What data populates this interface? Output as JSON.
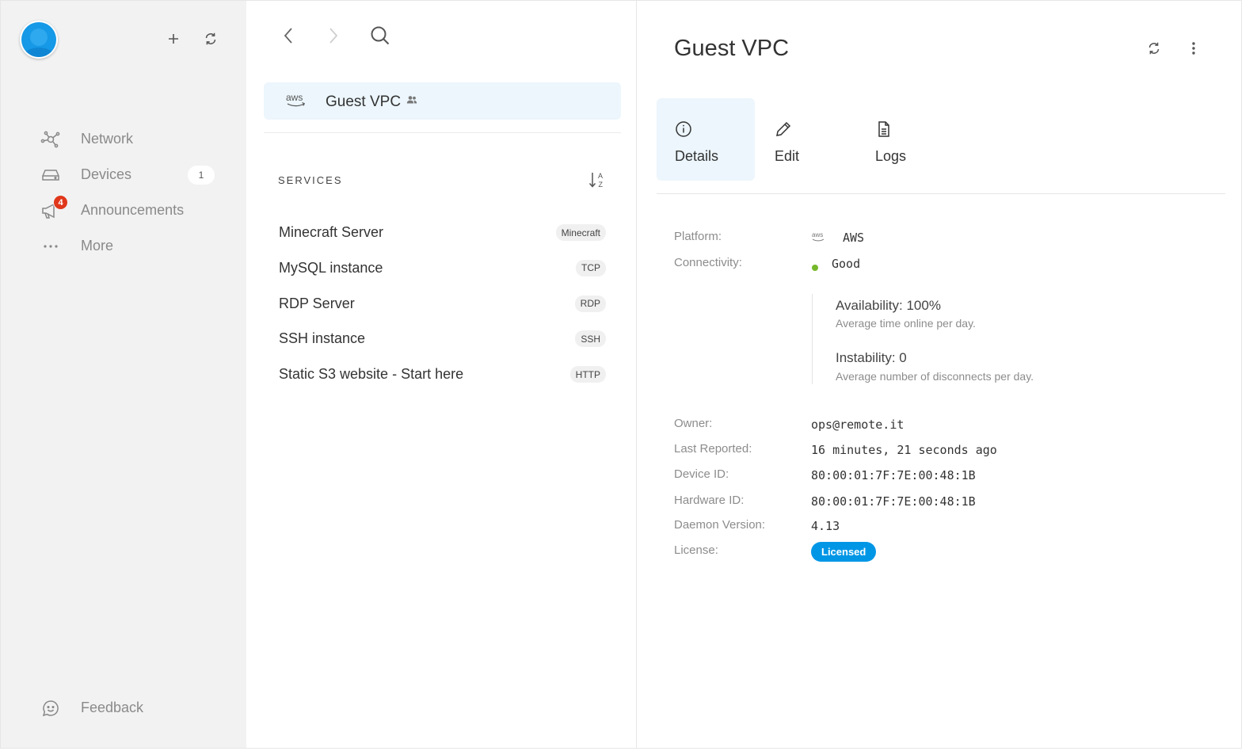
{
  "sidebar": {
    "nav": [
      {
        "label": "Network",
        "icon": "network-icon"
      },
      {
        "label": "Devices",
        "icon": "devices-icon",
        "count": "1"
      },
      {
        "label": "Announcements",
        "icon": "megaphone-icon",
        "badge": "4"
      },
      {
        "label": "More",
        "icon": "more-horizontal-icon"
      }
    ],
    "feedback_label": "Feedback"
  },
  "middle": {
    "device": {
      "platform_logo": "aws",
      "name": "Guest VPC"
    },
    "services_title": "SERVICES",
    "services": [
      {
        "name": "Minecraft Server",
        "type": "Minecraft"
      },
      {
        "name": "MySQL instance",
        "type": "TCP"
      },
      {
        "name": "RDP Server",
        "type": "RDP"
      },
      {
        "name": "SSH instance",
        "type": "SSH"
      },
      {
        "name": "Static S3 website - Start here",
        "type": "HTTP"
      }
    ]
  },
  "detail": {
    "title": "Guest VPC",
    "tabs": [
      {
        "label": "Details",
        "icon": "info-icon",
        "active": true
      },
      {
        "label": "Edit",
        "icon": "pencil-icon"
      },
      {
        "label": "Logs",
        "icon": "document-icon"
      }
    ],
    "platform_label": "Platform:",
    "platform_logo": "aws",
    "platform_value": "AWS",
    "connectivity_label": "Connectivity:",
    "connectivity_value": "Good",
    "availability": "Availability: 100%",
    "availability_desc": "Average time online per day.",
    "instability": "Instability: 0",
    "instability_desc": "Average number of disconnects per day.",
    "owner_label": "Owner:",
    "owner_value": "ops@remote.it",
    "last_reported_label": "Last Reported:",
    "last_reported_value": "16 minutes, 21 seconds ago",
    "device_id_label": "Device ID:",
    "device_id_value": "80:00:01:7F:7E:00:48:1B",
    "hardware_id_label": "Hardware ID:",
    "hardware_id_value": "80:00:01:7F:7E:00:48:1B",
    "daemon_label": "Daemon Version:",
    "daemon_value": "4.13",
    "license_label": "License:",
    "license_value": "Licensed"
  },
  "colors": {
    "accent": "#0096e6",
    "selected_bg": "#ecf6fc",
    "sidebar_bg": "#f2f2f2",
    "badge": "#e0371b",
    "status_good": "#75b82b"
  }
}
